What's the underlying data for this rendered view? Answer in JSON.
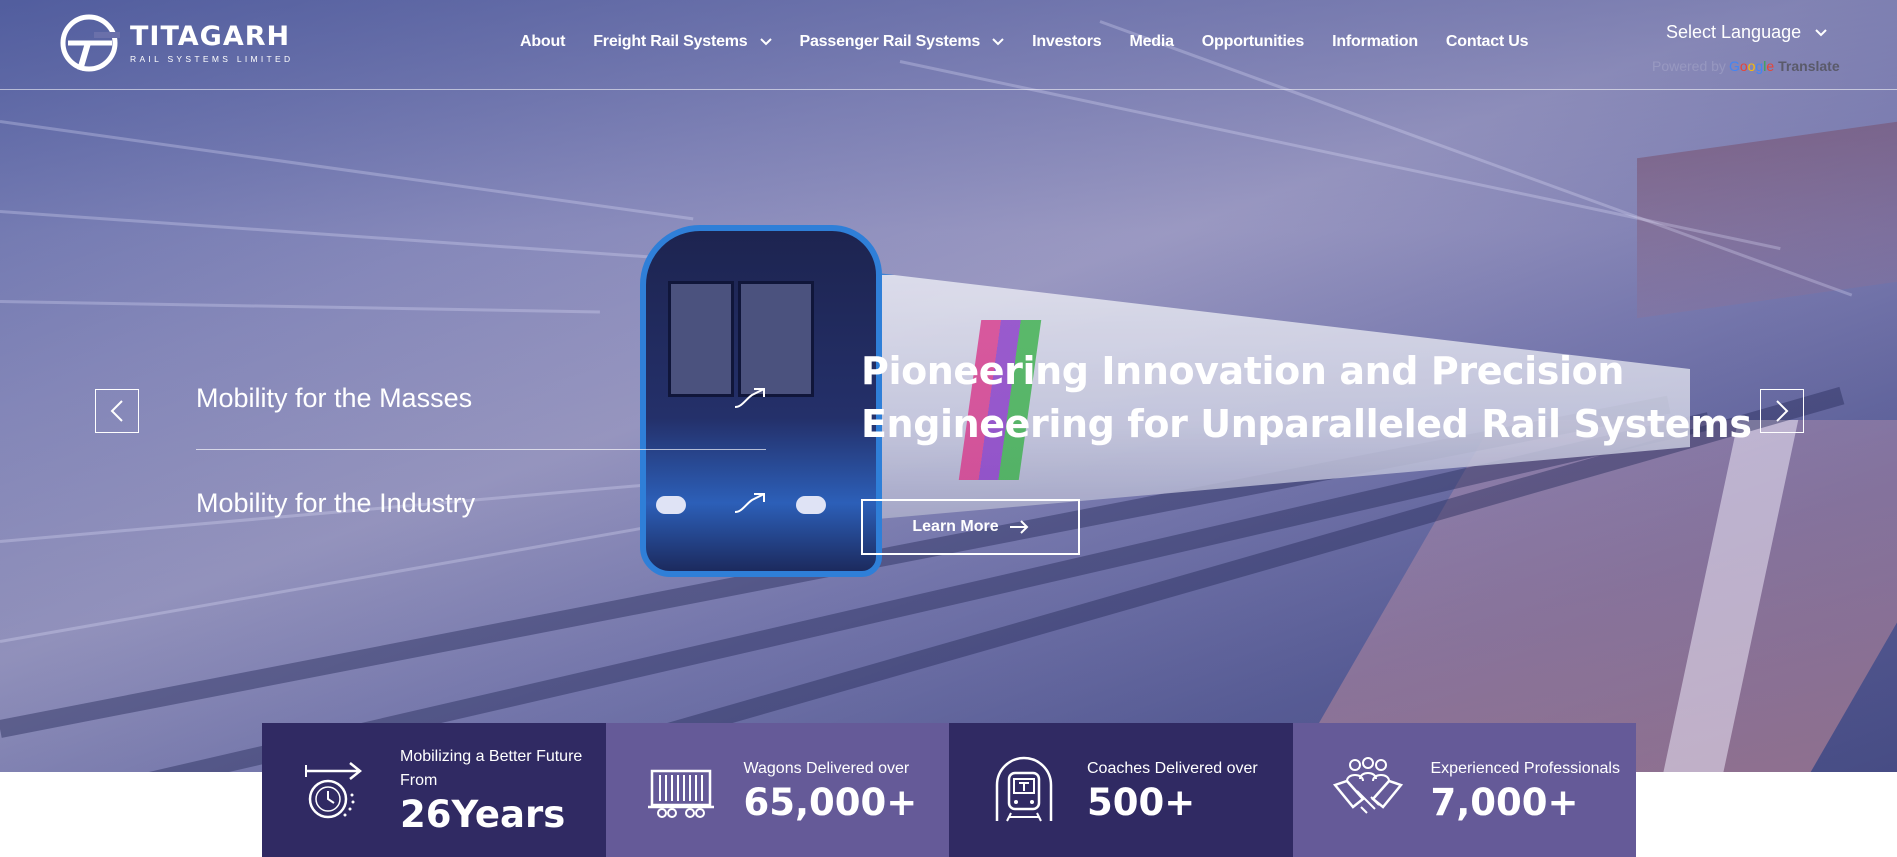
{
  "brand": {
    "name": "TITAGARH",
    "tagline": "RAIL SYSTEMS LIMITED"
  },
  "nav": {
    "items": [
      {
        "label": "About",
        "has_dropdown": false
      },
      {
        "label": "Freight Rail Systems",
        "has_dropdown": true
      },
      {
        "label": "Passenger Rail Systems",
        "has_dropdown": true
      },
      {
        "label": "Investors",
        "has_dropdown": false
      },
      {
        "label": "Media",
        "has_dropdown": false
      },
      {
        "label": "Opportunities",
        "has_dropdown": false
      },
      {
        "label": "Information",
        "has_dropdown": false
      },
      {
        "label": "Contact Us",
        "has_dropdown": false
      }
    ]
  },
  "language": {
    "selected": "Select Language",
    "powered_by": "Powered by",
    "google": [
      "G",
      "o",
      "o",
      "g",
      "l",
      "e"
    ],
    "translate": "Translate"
  },
  "hero": {
    "categories": [
      {
        "label": "Mobility for the Masses"
      },
      {
        "label": "Mobility for the Industry"
      }
    ],
    "headline": "Pioneering Innovation and Precision Engineering for Unparalleled Rail Systems",
    "cta": "Learn More"
  },
  "stats": [
    {
      "label": "Mobilizing a Better Future From",
      "value": "26Years",
      "icon": "clock-arrow-icon"
    },
    {
      "label": "Wagons Delivered over",
      "value": "65,000+",
      "icon": "wagon-icon"
    },
    {
      "label": "Coaches Delivered over",
      "value": "500+",
      "icon": "metro-coach-icon"
    },
    {
      "label": "Experienced Professionals",
      "value": "7,000+",
      "icon": "handshake-people-icon"
    }
  ],
  "colors": {
    "stat_dark": "#302a63",
    "stat_light": "#655a98",
    "text": "#ffffff"
  }
}
